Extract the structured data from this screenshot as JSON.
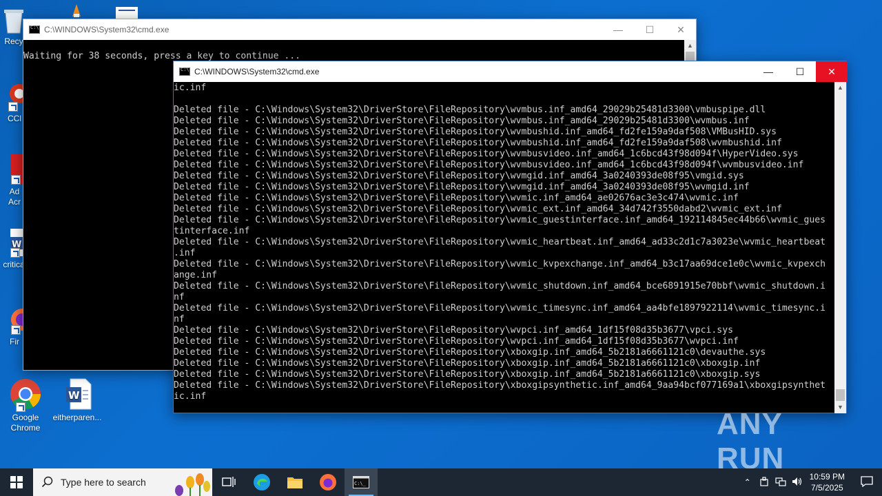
{
  "desktop": {
    "icons": [
      {
        "label": "Recy"
      },
      {
        "label": "CCl"
      },
      {
        "label": "Ad\nAcr"
      },
      {
        "label": "critica"
      },
      {
        "label": "Fir"
      },
      {
        "label": "Google\nChrome"
      },
      {
        "label": "eitherparen..."
      }
    ]
  },
  "back_window": {
    "title": "C:\\WINDOWS\\System32\\cmd.exe",
    "text": "Waiting for 38 seconds, press a key to continue ..."
  },
  "front_window": {
    "title": "C:\\WINDOWS\\System32\\cmd.exe",
    "lines": [
      "ic.inf",
      "",
      "Deleted file - C:\\Windows\\System32\\DriverStore\\FileRepository\\wvmbus.inf_amd64_29029b25481d3300\\vmbuspipe.dll",
      "Deleted file - C:\\Windows\\System32\\DriverStore\\FileRepository\\wvmbus.inf_amd64_29029b25481d3300\\wvmbus.inf",
      "Deleted file - C:\\Windows\\System32\\DriverStore\\FileRepository\\wvmbushid.inf_amd64_fd2fe159a9daf508\\VMBusHID.sys",
      "Deleted file - C:\\Windows\\System32\\DriverStore\\FileRepository\\wvmbushid.inf_amd64_fd2fe159a9daf508\\wvmbushid.inf",
      "Deleted file - C:\\Windows\\System32\\DriverStore\\FileRepository\\wvmbusvideo.inf_amd64_1c6bcd43f98d094f\\HyperVideo.sys",
      "Deleted file - C:\\Windows\\System32\\DriverStore\\FileRepository\\wvmbusvideo.inf_amd64_1c6bcd43f98d094f\\wvmbusvideo.inf",
      "Deleted file - C:\\Windows\\System32\\DriverStore\\FileRepository\\wvmgid.inf_amd64_3a0240393de08f95\\vmgid.sys",
      "Deleted file - C:\\Windows\\System32\\DriverStore\\FileRepository\\wvmgid.inf_amd64_3a0240393de08f95\\wvmgid.inf",
      "Deleted file - C:\\Windows\\System32\\DriverStore\\FileRepository\\wvmic.inf_amd64_ae02676ac3e3c474\\wvmic.inf",
      "Deleted file - C:\\Windows\\System32\\DriverStore\\FileRepository\\wvmic_ext.inf_amd64_34d742f3550dabd2\\wvmic_ext.inf",
      "Deleted file - C:\\Windows\\System32\\DriverStore\\FileRepository\\wvmic_guestinterface.inf_amd64_192114845ec44b66\\wvmic_gues",
      "tinterface.inf",
      "Deleted file - C:\\Windows\\System32\\DriverStore\\FileRepository\\wvmic_heartbeat.inf_amd64_ad33c2d1c7a3023e\\wvmic_heartbeat",
      ".inf",
      "Deleted file - C:\\Windows\\System32\\DriverStore\\FileRepository\\wvmic_kvpexchange.inf_amd64_b3c17aa69dce1e0c\\wvmic_kvpexch",
      "ange.inf",
      "Deleted file - C:\\Windows\\System32\\DriverStore\\FileRepository\\wvmic_shutdown.inf_amd64_bce6891915e70bbf\\wvmic_shutdown.i",
      "nf",
      "Deleted file - C:\\Windows\\System32\\DriverStore\\FileRepository\\wvmic_timesync.inf_amd64_aa4bfe1897922114\\wvmic_timesync.i",
      "nf",
      "Deleted file - C:\\Windows\\System32\\DriverStore\\FileRepository\\wvpci.inf_amd64_1df15f08d35b3677\\vpci.sys",
      "Deleted file - C:\\Windows\\System32\\DriverStore\\FileRepository\\wvpci.inf_amd64_1df15f08d35b3677\\wvpci.inf",
      "Deleted file - C:\\Windows\\System32\\DriverStore\\FileRepository\\xboxgip.inf_amd64_5b2181a6661121c0\\devauthe.sys",
      "Deleted file - C:\\Windows\\System32\\DriverStore\\FileRepository\\xboxgip.inf_amd64_5b2181a6661121c0\\xboxgip.inf",
      "Deleted file - C:\\Windows\\System32\\DriverStore\\FileRepository\\xboxgip.inf_amd64_5b2181a6661121c0\\xboxgip.sys",
      "Deleted file - C:\\Windows\\System32\\DriverStore\\FileRepository\\xboxgipsynthetic.inf_amd64_9aa94bcf077169a1\\xboxgipsynthet",
      "ic.inf"
    ]
  },
  "watermark": "ANY RUN",
  "taskbar": {
    "search_placeholder": "Type here to search",
    "time": "10:59 PM",
    "date": "7/5/2025"
  },
  "icons": [
    "windows-start-icon",
    "search-icon",
    "task-view-icon",
    "edge-icon",
    "file-explorer-icon",
    "firefox-icon",
    "cmd-icon",
    "chevron-up-icon",
    "security-icon",
    "network-icon",
    "volume-icon",
    "notification-icon"
  ],
  "colors": {
    "desktop": "#0b63c2",
    "taskbar": "#1c2733",
    "close_active": "#e81123",
    "console_text": "#cfcfcf"
  }
}
